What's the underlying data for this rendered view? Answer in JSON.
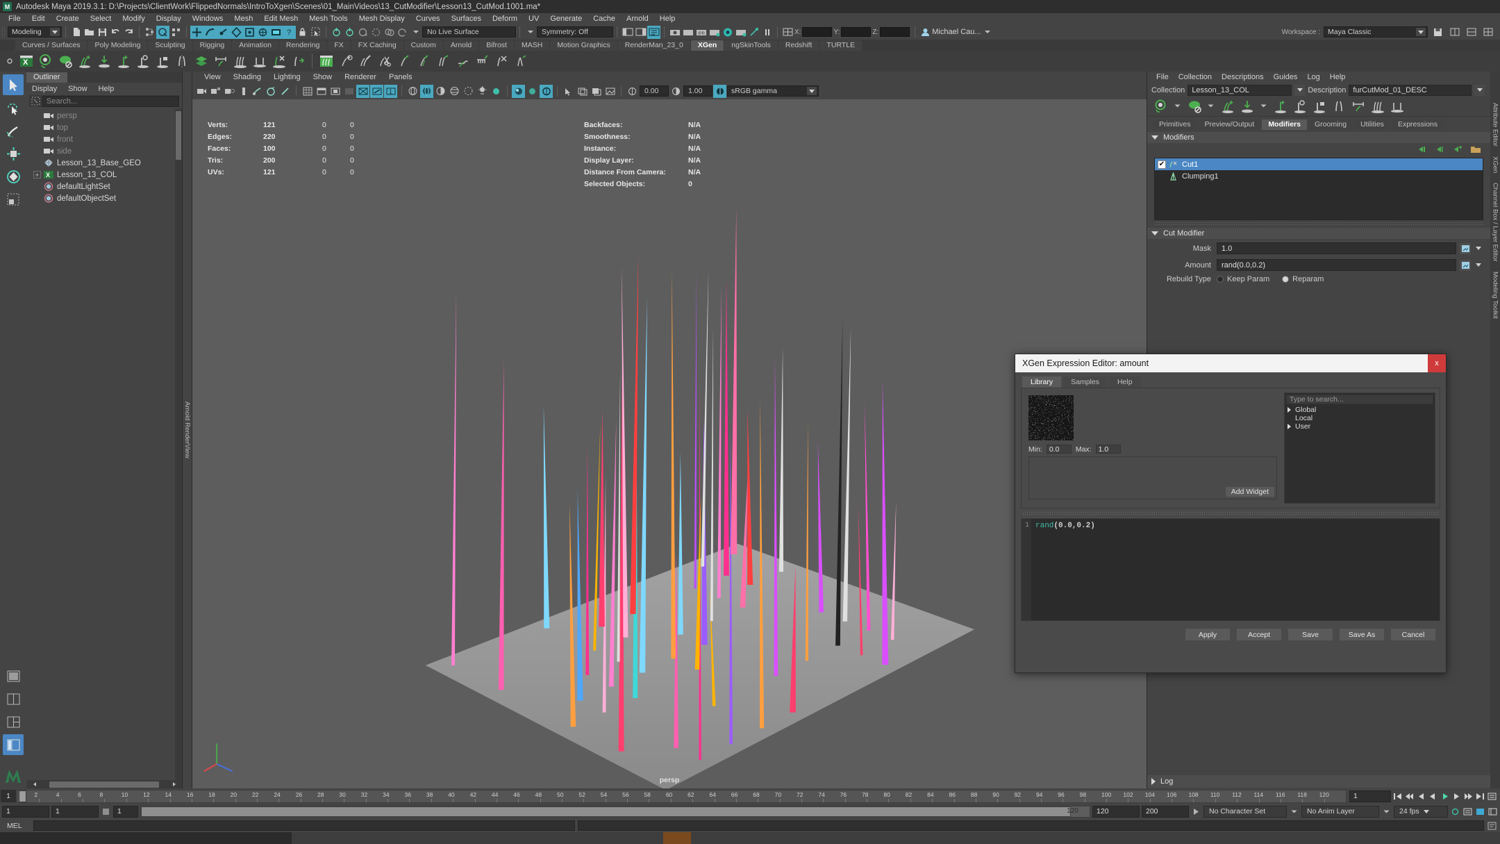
{
  "window": {
    "title": "Autodesk Maya 2019.3.1: D:\\Projects\\ClientWork\\FlippedNormals\\IntroToXgen\\Scenes\\01_MainVideos\\13_CutModifier\\Lesson13_CutMod.1001.ma*",
    "logo": "M"
  },
  "menubar": {
    "items": [
      "File",
      "Edit",
      "Create",
      "Select",
      "Modify",
      "Display",
      "Windows",
      "Mesh",
      "Edit Mesh",
      "Mesh Tools",
      "Mesh Display",
      "Curves",
      "Surfaces",
      "Deform",
      "UV",
      "Generate",
      "Cache",
      "Arnold",
      "Help"
    ]
  },
  "toolbar": {
    "menuset": "Modeling",
    "live_surface": "No Live Surface",
    "symmetry": "Symmetry: Off",
    "coord_x_label": "X:",
    "coord_y_label": "Y:",
    "coord_z_label": "Z:",
    "coord_x_value": "",
    "coord_y_value": "",
    "coord_z_value": "",
    "user": "Michael Cau...",
    "workspace_label": "Workspace :",
    "workspace_value": "Maya Classic"
  },
  "shelf": {
    "tabs": [
      "Curves / Surfaces",
      "Poly Modeling",
      "Sculpting",
      "Rigging",
      "Animation",
      "Rendering",
      "FX",
      "FX Caching",
      "Custom",
      "Arnold",
      "Bifrost",
      "MASH",
      "Motion Graphics",
      "RenderMan_23_0",
      "XGen",
      "ngSkinTools",
      "Redshift",
      "TURTLE"
    ],
    "active_tab": "XGen"
  },
  "outliner": {
    "tab": "Outliner",
    "menu": [
      "Display",
      "Show",
      "Help"
    ],
    "search_placeholder": "Search...",
    "items": [
      {
        "label": "persp",
        "icon": "camera-icon",
        "dim": true,
        "expandable": false
      },
      {
        "label": "top",
        "icon": "camera-icon",
        "dim": true,
        "expandable": false
      },
      {
        "label": "front",
        "icon": "camera-icon",
        "dim": true,
        "expandable": false
      },
      {
        "label": "side",
        "icon": "camera-icon",
        "dim": true,
        "expandable": false
      },
      {
        "label": "Lesson_13_Base_GEO",
        "icon": "mesh-icon",
        "dim": false,
        "expandable": false
      },
      {
        "label": "Lesson_13_COL",
        "icon": "xgen-icon",
        "dim": false,
        "expandable": true
      },
      {
        "label": "defaultLightSet",
        "icon": "set-icon",
        "dim": false,
        "expandable": false
      },
      {
        "label": "defaultObjectSet",
        "icon": "set-icon",
        "dim": false,
        "expandable": false
      }
    ]
  },
  "viewport": {
    "side_label": "Arnold RenderView",
    "menu": [
      "View",
      "Shading",
      "Lighting",
      "Show",
      "Renderer",
      "Panels"
    ],
    "exposure": "0.00",
    "gamma": "1.00",
    "color_space": "sRGB gamma",
    "camera_label": "persp",
    "hud_left": [
      {
        "key": "Verts:",
        "v1": "121",
        "v2": "0",
        "v3": "0"
      },
      {
        "key": "Edges:",
        "v1": "220",
        "v2": "0",
        "v3": "0"
      },
      {
        "key": "Faces:",
        "v1": "100",
        "v2": "0",
        "v3": "0"
      },
      {
        "key": "Tris:",
        "v1": "200",
        "v2": "0",
        "v3": "0"
      },
      {
        "key": "UVs:",
        "v1": "121",
        "v2": "0",
        "v3": "0"
      }
    ],
    "hud_right": [
      {
        "key": "Backfaces:",
        "v": "N/A"
      },
      {
        "key": "Smoothness:",
        "v": "N/A"
      },
      {
        "key": "Instance:",
        "v": "N/A"
      },
      {
        "key": "Display Layer:",
        "v": "N/A"
      },
      {
        "key": "Distance From Camera:",
        "v": "N/A"
      },
      {
        "key": "Selected Objects:",
        "v": "0"
      }
    ]
  },
  "xgen": {
    "menu": [
      "File",
      "Collection",
      "Descriptions",
      "Guides",
      "Log",
      "Help"
    ],
    "collection_label": "Collection",
    "collection_value": "Lesson_13_COL",
    "description_label": "Description",
    "description_value": "furCutMod_01_DESC",
    "tabs": [
      "Primitives",
      "Preview/Output",
      "Modifiers",
      "Grooming",
      "Utilities",
      "Expressions"
    ],
    "active_tab": "Modifiers",
    "section_modifiers": "Modifiers",
    "modifier_list": [
      {
        "label": "Cut1",
        "checked": true,
        "selected": true,
        "icon": "cut-modifier-icon"
      },
      {
        "label": "Clumping1",
        "checked": false,
        "selected": false,
        "icon": "clumping-modifier-icon"
      }
    ],
    "section_cut_modifier": "Cut Modifier",
    "mask_label": "Mask",
    "mask_value": "1.0",
    "amount_label": "Amount",
    "amount_value": "rand(0.0,0.2)",
    "rebuild_label": "Rebuild Type",
    "rebuild_options": [
      "Keep Param",
      "Reparam"
    ],
    "rebuild_selected": "Reparam",
    "log_label": "Log"
  },
  "right_tabs": [
    "Attribute Editor",
    "XGen",
    "Channel Box / Layer Editor",
    "Modeling Toolkit"
  ],
  "dialog": {
    "title": "XGen Expression Editor: amount",
    "close_glyph": "x",
    "tabs": [
      "Library",
      "Samples",
      "Help"
    ],
    "active_tab": "Library",
    "min_label": "Min:",
    "min_value": "0.0",
    "max_label": "Max:",
    "max_value": "1.0",
    "add_widget": "Add Widget",
    "search_placeholder": "Type to search...",
    "tree": [
      {
        "label": "Global",
        "expandable": true
      },
      {
        "label": "Local",
        "expandable": false
      },
      {
        "label": "User",
        "expandable": true
      }
    ],
    "code_line_no": "1",
    "code_fn": "rand",
    "code_args": "(0.0,0.2)",
    "buttons": [
      "Apply",
      "Accept",
      "Save",
      "Save As",
      "Cancel"
    ]
  },
  "timeslider": {
    "start_field": "1",
    "ticks": [
      "2",
      "4",
      "6",
      "8",
      "10",
      "12",
      "14",
      "16",
      "18",
      "20",
      "22",
      "24",
      "26",
      "28",
      "30",
      "32",
      "34",
      "36",
      "38",
      "40",
      "42",
      "44",
      "46",
      "48",
      "50",
      "52",
      "54",
      "56",
      "58",
      "60",
      "62",
      "64",
      "66",
      "68",
      "70",
      "72",
      "74",
      "76",
      "78",
      "80",
      "82",
      "84",
      "86",
      "88",
      "90",
      "92",
      "94",
      "96",
      "98",
      "100",
      "102",
      "104",
      "106",
      "108",
      "110",
      "112",
      "114",
      "116",
      "118",
      "120"
    ],
    "current_frame": "1",
    "frame_field": "1",
    "key_field": "1"
  },
  "rangebar": {
    "start": "1",
    "range_start": "1",
    "range_value": "1",
    "slider_label": "120",
    "end_1": "120",
    "end_2": "200",
    "char_set": "No Character Set",
    "anim_layer": "No Anim Layer",
    "fps": "24 fps"
  },
  "melbar": {
    "label": "MEL",
    "input": "",
    "output": ""
  },
  "colors": {
    "accent_blue": "#4b87c4",
    "accent_teal": "#4aa8c0",
    "xgen_green": "#3f9e5f",
    "close_red": "#cf3b3b",
    "panel_bg": "#444444",
    "viewport_bg": "#5d5d5d"
  },
  "chart_data": null
}
